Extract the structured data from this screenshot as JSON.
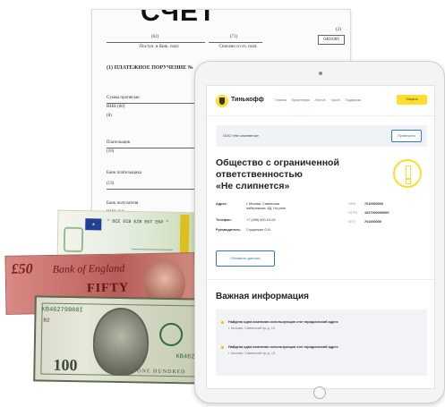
{
  "document": {
    "heading": "СЧЕТ",
    "code_left": "(62)",
    "code_mid": "(71)",
    "code_right": "(2)",
    "form_number": "0401060",
    "label_left": "Поступ. в банк. плат.",
    "label_mid": "Списано со сч. плат.",
    "title": "(1) ПЛАТЕЖНОЕ ПОРУЧЕНИЕ №",
    "fields": [
      "Сумма прописью",
      "ИНН (60)",
      "(8)",
      "Плательщик",
      "(10)",
      "Банк плательщика",
      "(13)",
      "Банк получателя",
      "ИНН (61)"
    ]
  },
  "banknotes": {
    "euro_serial": "* BCE ECB EZB EKT EKP *",
    "pound_big": "£50",
    "pound_bank": "Bank of England",
    "pound_fifty": "FIFTY",
    "dollar_serial_left": "KB46279860I",
    "dollar_serial_red": "B2",
    "dollar_serial_right": "KB4627",
    "dollar_denom": "100",
    "dollar_bottom": "ONE HUNDRED"
  },
  "site": {
    "logo": "Тинькофф",
    "logo_sub": "БИЗ",
    "nav": [
      "Главная",
      "Бухгалтерия",
      "Личный",
      "Чужой",
      "Поддержка"
    ],
    "nav_active_index": 1,
    "header_button": "Открыть",
    "search_value": "ООО «Не слипнется»",
    "check_button": "Проверить",
    "company_name_lines": [
      "Общество с ограниченной",
      "ответственностью",
      "«Не слипнется»"
    ],
    "address_label": "Адрес:",
    "address_value_1": "г. Москва, Савинская",
    "address_value_2": "набережная, 8Д, На реке",
    "phone_label": "Телефон:",
    "phone_value": "+7 (495) 000-01-00",
    "head_label": "Руководитель:",
    "head_value": "Сгущенкин О.В.",
    "inn_label": "ИНН",
    "inn_value": "7010000000",
    "ogrn_label": "ОГРН",
    "ogrn_value": "1027000000000",
    "kpp_label": "КПП",
    "kpp_value": "701000000",
    "update_button": "Обновить данные",
    "info_title": "Важная информация",
    "info_items": [
      {
        "title": "Найдена одна компания использующая этот юридический адрес",
        "address": "г. Москва, Савинский пр-д, 13"
      },
      {
        "title": "Найдена одна компания использующая этот юридический адрес",
        "address": "г. Москва, Савинский пр-д, 13"
      }
    ]
  },
  "colors": {
    "brand_yellow": "#ffdd2d",
    "link_blue": "#2f7bb6"
  }
}
